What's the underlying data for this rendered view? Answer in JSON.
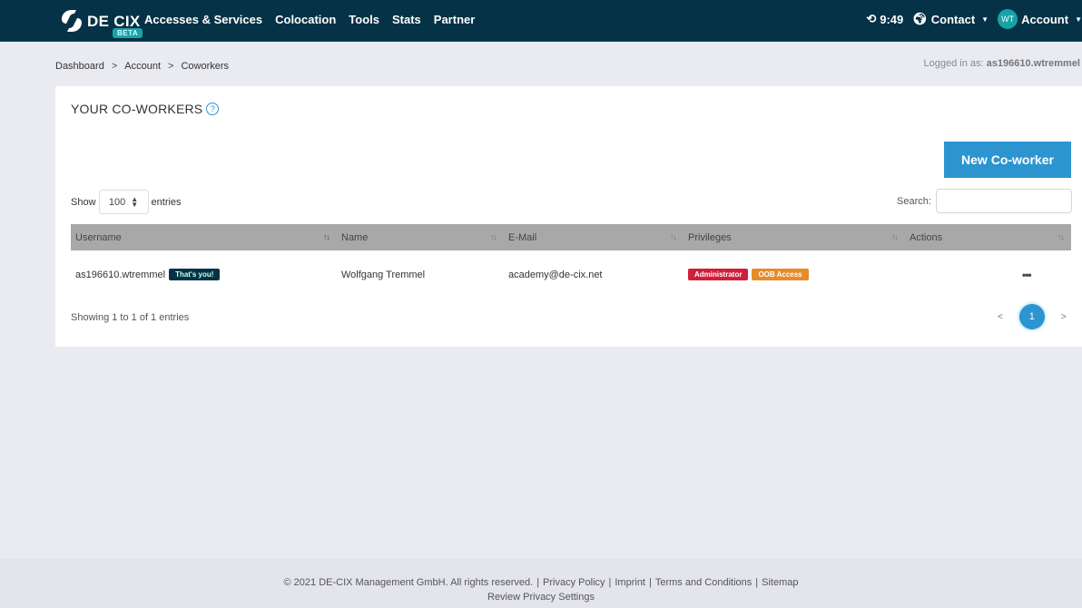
{
  "navbar": {
    "brand": "DE CIX",
    "beta_label": "BETA",
    "links": [
      "Accesses & Services",
      "Colocation",
      "Tools",
      "Stats",
      "Partner"
    ],
    "time": "9:49",
    "contact_label": "Contact",
    "avatar_initials": "WT",
    "account_label": "Account"
  },
  "breadcrumb": [
    "Dashboard",
    "Account",
    "Coworkers"
  ],
  "breadcrumb_sep": ">",
  "logged_in": {
    "label": "Logged in as:",
    "user": "as196610.wtremmel"
  },
  "card": {
    "title": "YOUR CO-WORKERS",
    "new_button": "New Co-worker",
    "show_label": "Show",
    "entries_label": "entries",
    "page_size": "100",
    "search_label": "Search:",
    "search_value": ""
  },
  "table": {
    "headers": [
      "Username",
      "Name",
      "E-Mail",
      "Privileges",
      "Actions"
    ],
    "rows": [
      {
        "username": "as196610.wtremmel",
        "self_badge": "That's you!",
        "name": "Wolfgang Tremmel",
        "email": "academy@de-cix.net",
        "privileges": [
          "Administrator",
          "OOB Access"
        ],
        "actions": "•••"
      }
    ]
  },
  "pagination": {
    "summary": "Showing 1 to 1 of 1 entries",
    "prev": "<",
    "current_page": "1",
    "next": ">"
  },
  "footer": {
    "copyright": "© 2021 DE-CIX Management GmbH. All rights reserved.",
    "links": [
      "Privacy Policy",
      "Imprint",
      "Terms and Conditions",
      "Sitemap"
    ],
    "privacy_settings": "Review Privacy Settings"
  },
  "colors": {
    "navbar": "#053246",
    "primary": "#2c95cf",
    "admin_badge": "#cf1f3a",
    "oob_badge": "#e88b2a"
  }
}
